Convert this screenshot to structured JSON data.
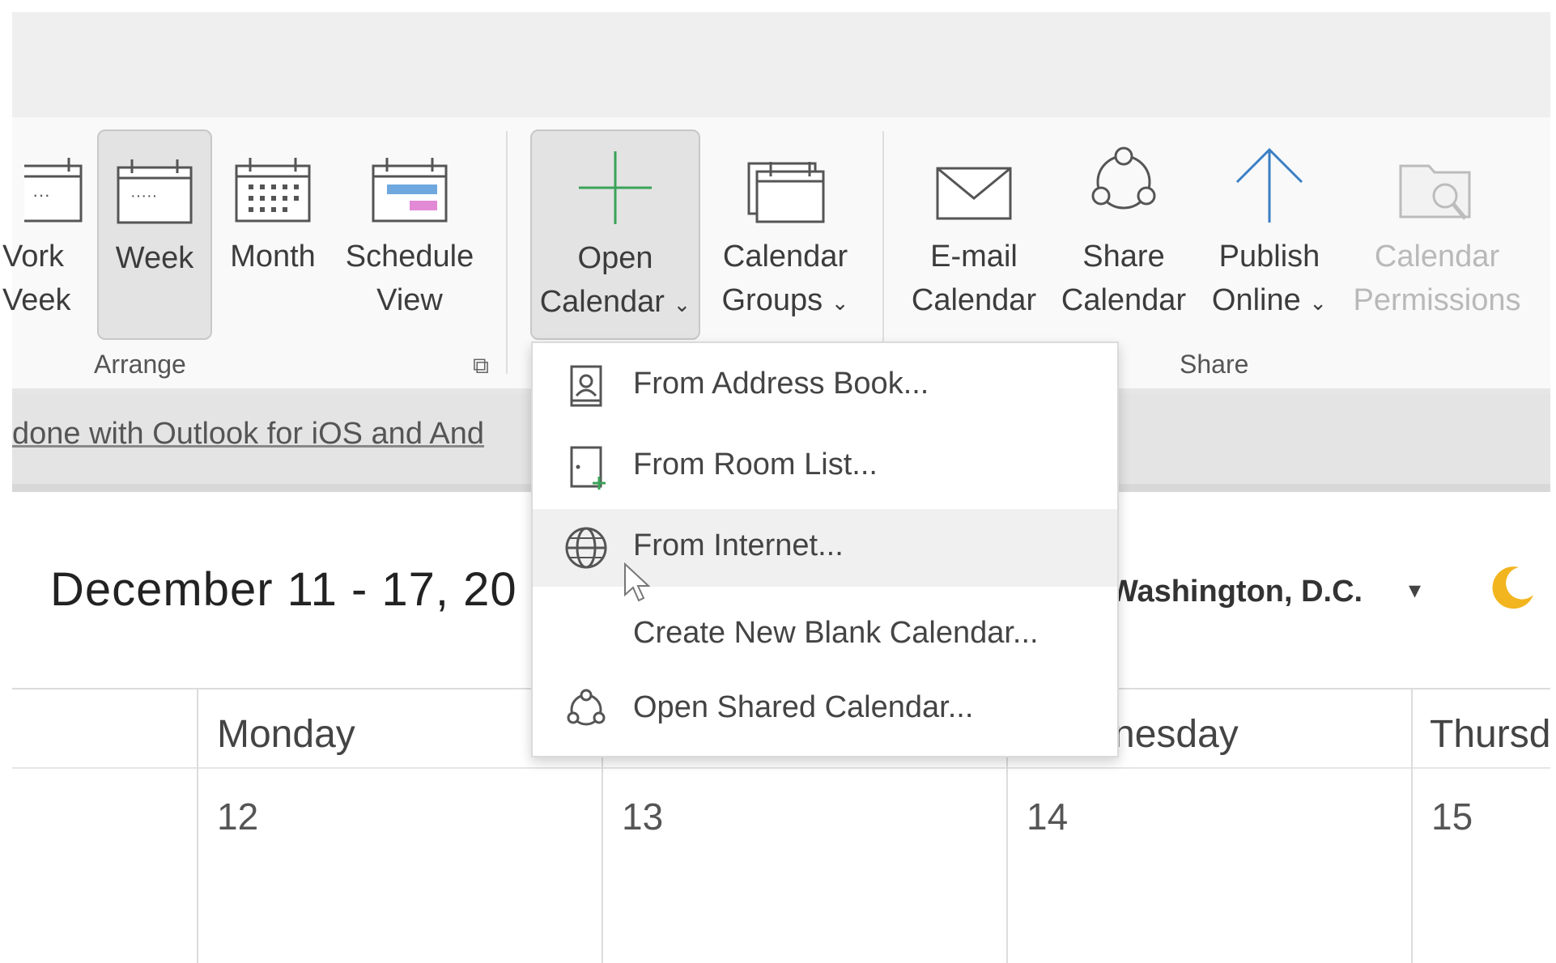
{
  "ribbon": {
    "buttons": {
      "work_week_line1": "Vork",
      "work_week_line2": "Veek",
      "week": "Week",
      "month": "Month",
      "schedule_view_line1": "Schedule",
      "schedule_view_line2": "View",
      "open_calendar_line1": "Open",
      "open_calendar_line2": "Calendar",
      "calendar_groups_line1": "Calendar",
      "calendar_groups_line2": "Groups",
      "email_calendar_line1": "E-mail",
      "email_calendar_line2": "Calendar",
      "share_calendar_line1": "Share",
      "share_calendar_line2": "Calendar",
      "publish_online_line1": "Publish",
      "publish_online_line2": "Online",
      "calendar_permissions_line1": "Calendar",
      "calendar_permissions_line2": "Permissions"
    },
    "groups": {
      "arrange": "Arrange",
      "share": "Share"
    },
    "caret": "⌄",
    "dialog_launcher": "⧉"
  },
  "infobar": {
    "text": "done with Outlook for iOS and And"
  },
  "open_calendar_menu": {
    "items": [
      {
        "label": "From Address Book...",
        "icon": "address-book-icon"
      },
      {
        "label": "From Room List...",
        "icon": "room-list-icon"
      },
      {
        "label": "From Internet...",
        "icon": "globe-icon"
      },
      {
        "label": "Create New Blank Calendar...",
        "icon": ""
      },
      {
        "label": "Open Shared Calendar...",
        "icon": "shared-calendar-icon"
      }
    ]
  },
  "calendar": {
    "date_range": "December 11 - 17, 20",
    "timezone": "Washington, D.C.",
    "timezone_caret": "▾",
    "days": [
      {
        "name": "Monday",
        "number": "12"
      },
      {
        "name": "",
        "number": "13"
      },
      {
        "name": "nesday",
        "number": "14"
      },
      {
        "name": "Thursd",
        "number": "15"
      }
    ]
  },
  "colors": {
    "accent_green": "#3aa35a",
    "accent_blue": "#3a7fc4",
    "moon_yellow": "#f2b51f"
  }
}
